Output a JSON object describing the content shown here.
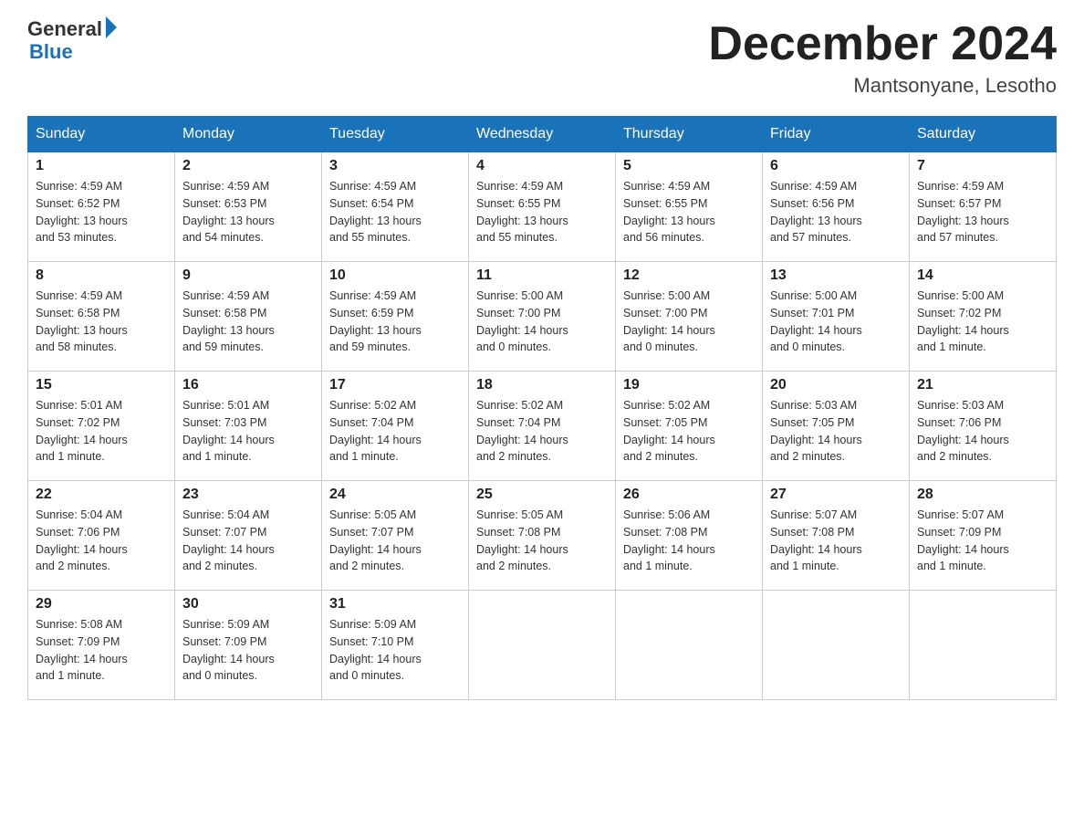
{
  "header": {
    "logo_line1": "General",
    "logo_line2": "Blue",
    "month_title": "December 2024",
    "location": "Mantsonyane, Lesotho"
  },
  "days_of_week": [
    "Sunday",
    "Monday",
    "Tuesday",
    "Wednesday",
    "Thursday",
    "Friday",
    "Saturday"
  ],
  "weeks": [
    [
      {
        "day": "1",
        "sunrise": "4:59 AM",
        "sunset": "6:52 PM",
        "daylight": "13 hours and 53 minutes."
      },
      {
        "day": "2",
        "sunrise": "4:59 AM",
        "sunset": "6:53 PM",
        "daylight": "13 hours and 54 minutes."
      },
      {
        "day": "3",
        "sunrise": "4:59 AM",
        "sunset": "6:54 PM",
        "daylight": "13 hours and 55 minutes."
      },
      {
        "day": "4",
        "sunrise": "4:59 AM",
        "sunset": "6:55 PM",
        "daylight": "13 hours and 55 minutes."
      },
      {
        "day": "5",
        "sunrise": "4:59 AM",
        "sunset": "6:55 PM",
        "daylight": "13 hours and 56 minutes."
      },
      {
        "day": "6",
        "sunrise": "4:59 AM",
        "sunset": "6:56 PM",
        "daylight": "13 hours and 57 minutes."
      },
      {
        "day": "7",
        "sunrise": "4:59 AM",
        "sunset": "6:57 PM",
        "daylight": "13 hours and 57 minutes."
      }
    ],
    [
      {
        "day": "8",
        "sunrise": "4:59 AM",
        "sunset": "6:58 PM",
        "daylight": "13 hours and 58 minutes."
      },
      {
        "day": "9",
        "sunrise": "4:59 AM",
        "sunset": "6:58 PM",
        "daylight": "13 hours and 59 minutes."
      },
      {
        "day": "10",
        "sunrise": "4:59 AM",
        "sunset": "6:59 PM",
        "daylight": "13 hours and 59 minutes."
      },
      {
        "day": "11",
        "sunrise": "5:00 AM",
        "sunset": "7:00 PM",
        "daylight": "14 hours and 0 minutes."
      },
      {
        "day": "12",
        "sunrise": "5:00 AM",
        "sunset": "7:00 PM",
        "daylight": "14 hours and 0 minutes."
      },
      {
        "day": "13",
        "sunrise": "5:00 AM",
        "sunset": "7:01 PM",
        "daylight": "14 hours and 0 minutes."
      },
      {
        "day": "14",
        "sunrise": "5:00 AM",
        "sunset": "7:02 PM",
        "daylight": "14 hours and 1 minute."
      }
    ],
    [
      {
        "day": "15",
        "sunrise": "5:01 AM",
        "sunset": "7:02 PM",
        "daylight": "14 hours and 1 minute."
      },
      {
        "day": "16",
        "sunrise": "5:01 AM",
        "sunset": "7:03 PM",
        "daylight": "14 hours and 1 minute."
      },
      {
        "day": "17",
        "sunrise": "5:02 AM",
        "sunset": "7:04 PM",
        "daylight": "14 hours and 1 minute."
      },
      {
        "day": "18",
        "sunrise": "5:02 AM",
        "sunset": "7:04 PM",
        "daylight": "14 hours and 2 minutes."
      },
      {
        "day": "19",
        "sunrise": "5:02 AM",
        "sunset": "7:05 PM",
        "daylight": "14 hours and 2 minutes."
      },
      {
        "day": "20",
        "sunrise": "5:03 AM",
        "sunset": "7:05 PM",
        "daylight": "14 hours and 2 minutes."
      },
      {
        "day": "21",
        "sunrise": "5:03 AM",
        "sunset": "7:06 PM",
        "daylight": "14 hours and 2 minutes."
      }
    ],
    [
      {
        "day": "22",
        "sunrise": "5:04 AM",
        "sunset": "7:06 PM",
        "daylight": "14 hours and 2 minutes."
      },
      {
        "day": "23",
        "sunrise": "5:04 AM",
        "sunset": "7:07 PM",
        "daylight": "14 hours and 2 minutes."
      },
      {
        "day": "24",
        "sunrise": "5:05 AM",
        "sunset": "7:07 PM",
        "daylight": "14 hours and 2 minutes."
      },
      {
        "day": "25",
        "sunrise": "5:05 AM",
        "sunset": "7:08 PM",
        "daylight": "14 hours and 2 minutes."
      },
      {
        "day": "26",
        "sunrise": "5:06 AM",
        "sunset": "7:08 PM",
        "daylight": "14 hours and 1 minute."
      },
      {
        "day": "27",
        "sunrise": "5:07 AM",
        "sunset": "7:08 PM",
        "daylight": "14 hours and 1 minute."
      },
      {
        "day": "28",
        "sunrise": "5:07 AM",
        "sunset": "7:09 PM",
        "daylight": "14 hours and 1 minute."
      }
    ],
    [
      {
        "day": "29",
        "sunrise": "5:08 AM",
        "sunset": "7:09 PM",
        "daylight": "14 hours and 1 minute."
      },
      {
        "day": "30",
        "sunrise": "5:09 AM",
        "sunset": "7:09 PM",
        "daylight": "14 hours and 0 minutes."
      },
      {
        "day": "31",
        "sunrise": "5:09 AM",
        "sunset": "7:10 PM",
        "daylight": "14 hours and 0 minutes."
      },
      null,
      null,
      null,
      null
    ]
  ],
  "labels": {
    "sunrise": "Sunrise:",
    "sunset": "Sunset:",
    "daylight": "Daylight:"
  }
}
